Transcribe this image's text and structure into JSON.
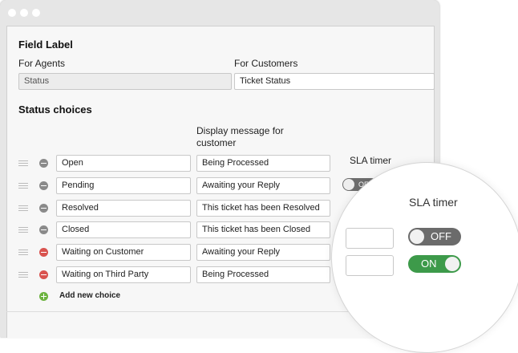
{
  "field_label": {
    "heading": "Field Label",
    "agents_label": "For Agents",
    "customers_label": "For Customers",
    "agents_value": "Status",
    "customers_value": "Ticket Status"
  },
  "status_choices": {
    "heading": "Status choices",
    "display_message_header": "Display message for customer",
    "sla_header": "SLA timer",
    "rows": [
      {
        "name": "Open",
        "message": "Being Processed",
        "removable": false
      },
      {
        "name": "Pending",
        "message": "Awaiting your Reply",
        "removable": false
      },
      {
        "name": "Resolved",
        "message": "This ticket has been Resolved",
        "removable": false
      },
      {
        "name": "Closed",
        "message": "This ticket has been Closed",
        "removable": false
      },
      {
        "name": "Waiting on Customer",
        "message": "Awaiting your Reply",
        "removable": true
      },
      {
        "name": "Waiting on Third Party",
        "message": "Being Processed",
        "removable": true
      }
    ],
    "add_new_choice": "Add new choice"
  },
  "sla_small_toggle": {
    "label": "OFF",
    "state": "off"
  },
  "magnifier": {
    "title": "SLA timer",
    "toggle_off_label": "OFF",
    "toggle_on_label": "ON"
  },
  "colors": {
    "remove_red": "#d9534f",
    "remove_gray": "#8a8a8a",
    "add_green": "#6cb33f",
    "toggle_on": "#3d9a4a",
    "toggle_off": "#6b6b6b"
  }
}
